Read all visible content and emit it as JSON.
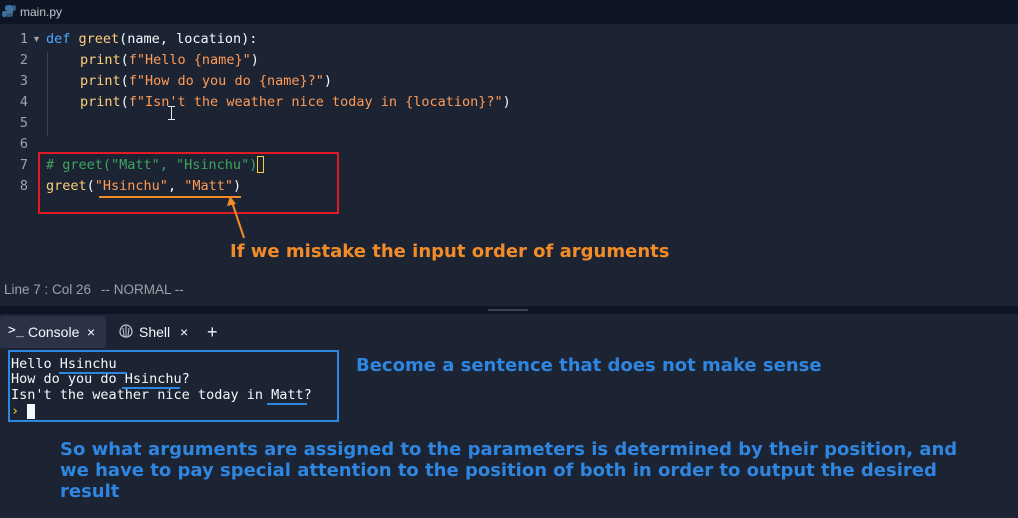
{
  "tab": {
    "filename": "main.py"
  },
  "editor": {
    "lines": [
      {
        "num": "1"
      },
      {
        "num": "2"
      },
      {
        "num": "3"
      },
      {
        "num": "4"
      },
      {
        "num": "5"
      },
      {
        "num": "6"
      },
      {
        "num": "7"
      },
      {
        "num": "8"
      }
    ],
    "code": {
      "l1_kw": "def",
      "l1_fn": "greet",
      "l1_rest": "(name, location):",
      "l2_fn": "print",
      "l2_str": "f\"Hello {name}\"",
      "l3_fn": "print",
      "l3_str": "f\"How do you do {name}?\"",
      "l4_fn": "print",
      "l4_str": "f\"Isn't the weather nice today in {location}?\"",
      "l7_comment": "# greet(\"Matt\", \"Hsinchu\")",
      "l8_fn": "greet",
      "l8_str1": "\"Hsinchu\"",
      "l8_str2": "\"Matt\""
    }
  },
  "status": {
    "position": "Line 7 : Col 26",
    "mode": "-- NORMAL --"
  },
  "tabs": {
    "console": "Console",
    "shell": "Shell",
    "add": "+",
    "close": "×"
  },
  "console": {
    "lines": [
      "Hello Hsinchu",
      "How do you do Hsinchu?",
      "Isn't the weather nice today in Matt?"
    ],
    "prompt": "›"
  },
  "annotations": {
    "mistake": "If we mistake the input order of arguments",
    "sentence": "Become a sentence that does not make sense",
    "summary": "So what arguments are assigned to the parameters is determined by their position, and we have to pay special attention to the position of both in order to output the desired result"
  },
  "colors": {
    "annotation_orange": "#f28c28",
    "annotation_blue": "#2f86e0",
    "box_red": "#e01b24",
    "box_blue": "#2f86e0"
  }
}
